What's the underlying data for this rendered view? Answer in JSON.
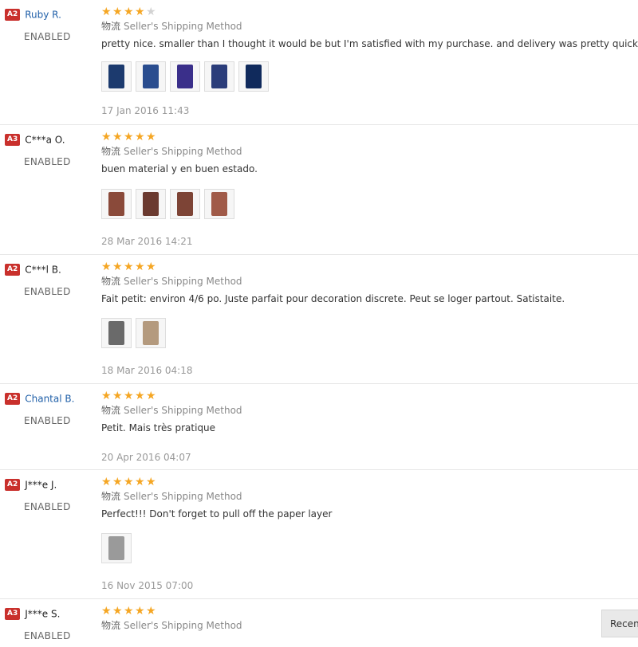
{
  "ship_prefix_cn": "物流",
  "ship_method": "Seller's Shipping Method",
  "colors": {
    "star_on": "#f5a623",
    "star_off": "#d2d2d2",
    "badge": "#c9302c",
    "link": "#1f5fa8"
  },
  "reviews": [
    {
      "level": "A2",
      "name": "Ruby R.",
      "status": "ENABLED",
      "stars": 4,
      "comment": "pretty nice. smaller than I thought it would be but I'm satisfied with my purchase. and delivery was pretty quick .",
      "photos": 5,
      "date": "17 Jan 2016 11:43"
    },
    {
      "level": "A3",
      "name": "C***a O.",
      "status": "ENABLED",
      "stars": 5,
      "comment": "buen material y en buen estado.",
      "photos": 4,
      "date": "28 Mar 2016 14:21"
    },
    {
      "level": "A2",
      "name": "C***l B.",
      "status": "ENABLED",
      "stars": 5,
      "comment": "Fait petit: environ 4/6 po. Juste parfait pour decoration discrete. Peut se loger partout. Satistaite.",
      "photos": 2,
      "date": "18 Mar 2016 04:18"
    },
    {
      "level": "A2",
      "name": "Chantal B.",
      "status": "ENABLED",
      "stars": 5,
      "comment": "Petit. Mais très pratique",
      "photos": 0,
      "date": "20 Apr 2016 04:07"
    },
    {
      "level": "A2",
      "name": "J***e J.",
      "status": "ENABLED",
      "stars": 5,
      "comment": "Perfect!!! Don't forget to pull off the paper layer",
      "photos": 1,
      "date": "16 Nov 2015 07:00"
    },
    {
      "level": "A3",
      "name": "J***e S.",
      "status": "ENABLED",
      "stars": 5,
      "comment": "",
      "photos": 0,
      "date": ""
    }
  ],
  "recent_button": "Recen"
}
